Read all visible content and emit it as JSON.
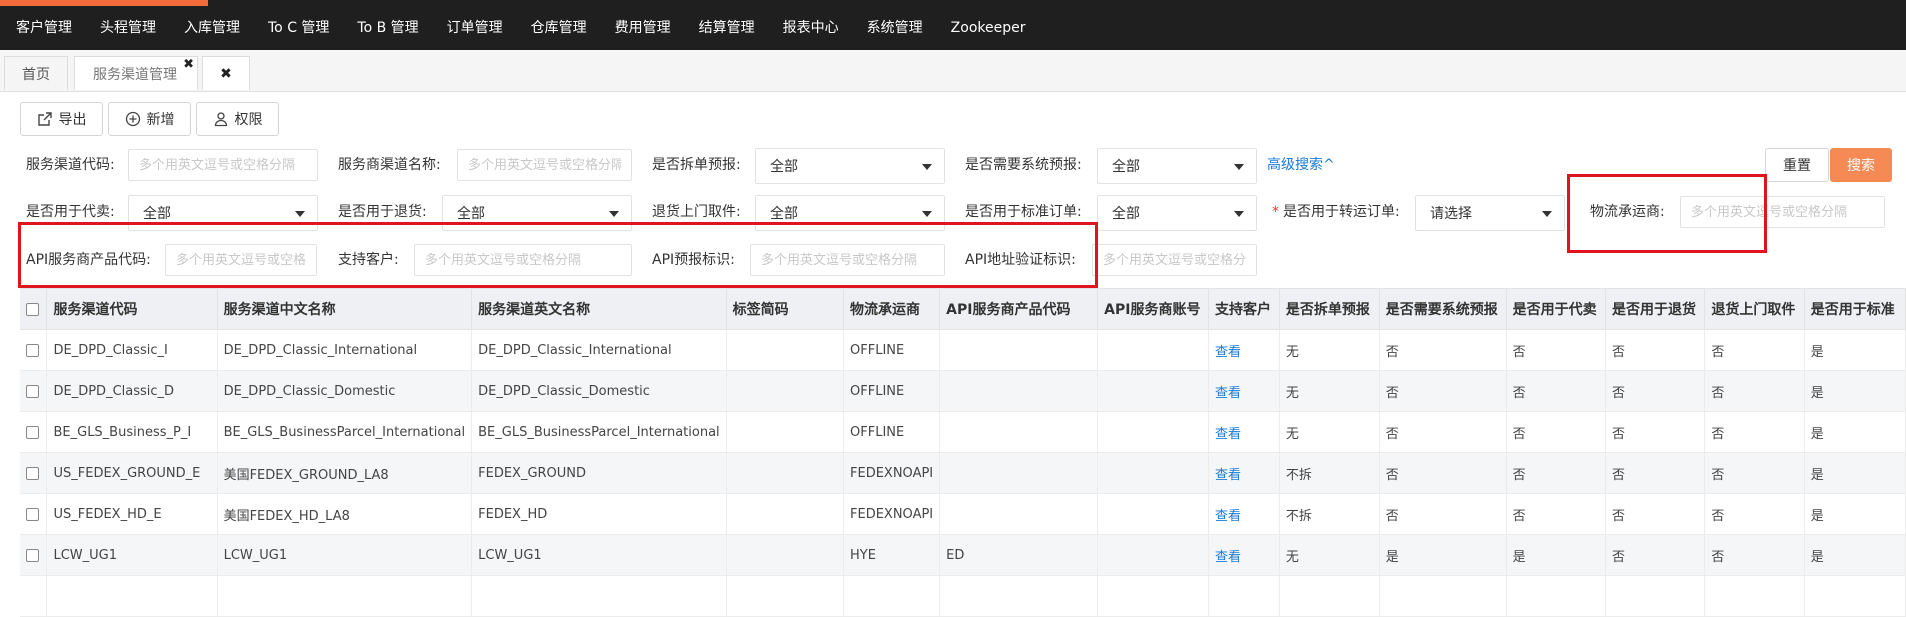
{
  "nav": [
    "客户管理",
    "头程管理",
    "入库管理",
    "To C 管理",
    "To B 管理",
    "订单管理",
    "仓库管理",
    "费用管理",
    "结算管理",
    "报表中心",
    "系统管理",
    "Zookeeper"
  ],
  "tabs": {
    "home": "首页",
    "active": "服务渠道管理",
    "close_glyph": "✖",
    "close_all_glyph": "✖"
  },
  "toolbar": {
    "export": "导出",
    "add": "新增",
    "permission": "权限"
  },
  "filters": {
    "service_code_label": "服务渠道代码:",
    "service_name_label": "服务商渠道名称:",
    "split_label": "是否拆单预报:",
    "need_sys_label": "是否需要系统预报:",
    "advanced": "高级搜索^",
    "reset": "重置",
    "search": "搜索",
    "agent_label": "是否用于代卖:",
    "return_label": "是否用于退货:",
    "pickup_label": "退货上门取件:",
    "standard_label": "是否用于标准订单:",
    "required_mark": "*",
    "transfer_label": "是否用于转运订单:",
    "carrier_label": "物流承运商:",
    "api_product_label": "API服务商产品代码:",
    "customer_label": "支持客户:",
    "api_forecast_label": "API预报标识:",
    "api_address_label": "API地址验证标识:",
    "placeholder": "多个用英文逗号或空格分隔",
    "all": "全部",
    "choose": "请选择"
  },
  "table": {
    "headers": [
      "服务渠道代码",
      "服务渠道中文名称",
      "服务渠道英文名称",
      "标签简码",
      "物流承运商",
      "API服务商产品代码",
      "API服务商账号",
      "支持客户",
      "是否拆单预报",
      "是否需要系统预报",
      "是否用于代卖",
      "是否用于退货",
      "退货上门取件",
      "是否用于标准"
    ],
    "rows": [
      [
        "DE_DPD_Classic_I",
        "DE_DPD_Classic_International",
        "DE_DPD_Classic_International",
        "",
        "OFFLINE",
        "",
        "",
        "查看",
        "无",
        "否",
        "否",
        "否",
        "否",
        "是"
      ],
      [
        "DE_DPD_Classic_D",
        "DE_DPD_Classic_Domestic",
        "DE_DPD_Classic_Domestic",
        "",
        "OFFLINE",
        "",
        "",
        "查看",
        "无",
        "否",
        "否",
        "否",
        "否",
        "是"
      ],
      [
        "BE_GLS_Business_P_I",
        "BE_GLS_BusinessParcel_International",
        "BE_GLS_BusinessParcel_International",
        "",
        "OFFLINE",
        "",
        "",
        "查看",
        "无",
        "否",
        "否",
        "否",
        "否",
        "是"
      ],
      [
        "US_FEDEX_GROUND_E",
        "美国FEDEX_GROUND_LA8",
        "FEDEX_GROUND",
        "",
        "FEDEXNOAPI",
        "",
        "",
        "查看",
        "不拆",
        "否",
        "否",
        "否",
        "否",
        "是"
      ],
      [
        "US_FEDEX_HD_E",
        "美国FEDEX_HD_LA8",
        "FEDEX_HD",
        "",
        "FEDEXNOAPI",
        "",
        "",
        "查看",
        "不拆",
        "否",
        "否",
        "否",
        "否",
        "是"
      ],
      [
        "LCW_UG1",
        "LCW_UG1",
        "LCW_UG1",
        "",
        "HYE",
        "ED",
        "",
        "查看",
        "无",
        "是",
        "是",
        "否",
        "否",
        "是"
      ],
      [
        "",
        "",
        "",
        "",
        "",
        "",
        "",
        "",
        "",
        "",
        "",
        "",
        "",
        ""
      ]
    ]
  },
  "colors": {
    "topbar": "#1f1f1f",
    "accent": "#f26b3a",
    "search_button": "#f58a55",
    "link": "#1a7bd6",
    "highlight": "#e0141e"
  }
}
